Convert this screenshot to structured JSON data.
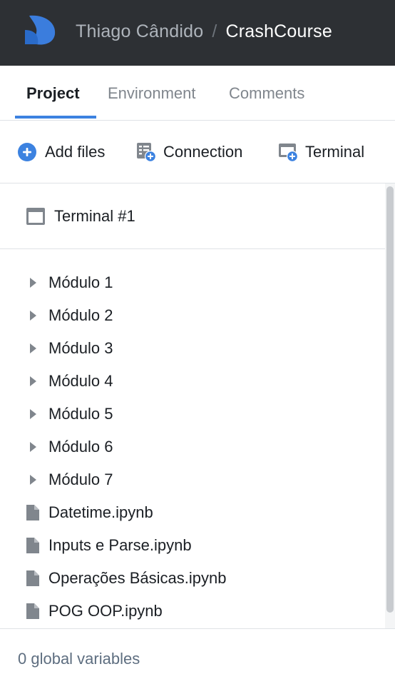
{
  "header": {
    "user": "Thiago Cândido",
    "separator": "/",
    "project": "CrashCourse",
    "logo_icon": "deepnote-logo-icon",
    "background": "#2d3034"
  },
  "tabs": [
    {
      "label": "Project",
      "active": true
    },
    {
      "label": "Environment",
      "active": false
    },
    {
      "label": "Comments",
      "active": false
    }
  ],
  "toolbar": {
    "add_files": {
      "label": "Add files",
      "icon": "plus-circle-icon"
    },
    "connection": {
      "label": "Connection",
      "icon": "connection-add-icon"
    },
    "terminal": {
      "label": "Terminal",
      "icon": "terminal-add-icon"
    }
  },
  "terminals": [
    {
      "label": "Terminal #1",
      "icon": "terminal-icon"
    }
  ],
  "files": [
    {
      "name": "Módulo 1",
      "type": "folder"
    },
    {
      "name": "Módulo 2",
      "type": "folder"
    },
    {
      "name": "Módulo 3",
      "type": "folder"
    },
    {
      "name": "Módulo 4",
      "type": "folder"
    },
    {
      "name": "Módulo 5",
      "type": "folder"
    },
    {
      "name": "Módulo 6",
      "type": "folder"
    },
    {
      "name": "Módulo 7",
      "type": "folder"
    },
    {
      "name": "Datetime.ipynb",
      "type": "file"
    },
    {
      "name": "Inputs e Parse.ipynb",
      "type": "file"
    },
    {
      "name": "Operações Básicas.ipynb",
      "type": "file"
    },
    {
      "name": "POG OOP.ipynb",
      "type": "file"
    }
  ],
  "footer": {
    "variables": "0 global variables"
  },
  "colors": {
    "accent": "#3c82e0",
    "icon_gray": "#80868d"
  }
}
